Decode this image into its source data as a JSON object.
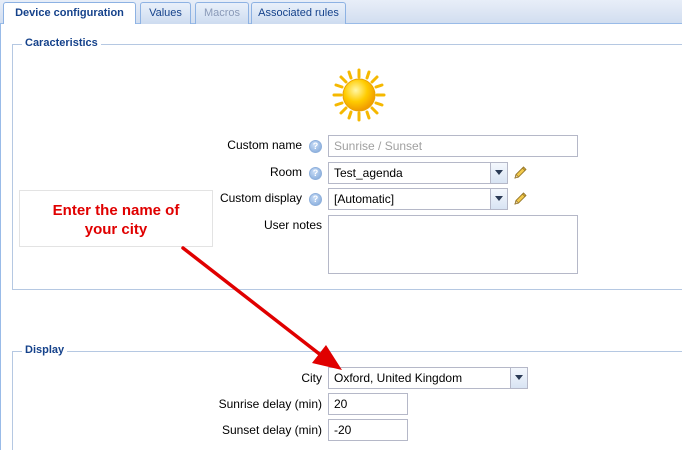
{
  "tabs": [
    {
      "label": "Device configuration",
      "active": true
    },
    {
      "label": "Values",
      "active": false
    },
    {
      "label": "Macros",
      "active": false,
      "disabled": true
    },
    {
      "label": "Associated rules",
      "active": false
    }
  ],
  "characteristics": {
    "legend": "Caracteristics",
    "device_icon": "sun-icon",
    "custom_name": {
      "label": "Custom name",
      "value": "",
      "placeholder": "Sunrise / Sunset"
    },
    "room": {
      "label": "Room",
      "value": "Test_agenda"
    },
    "custom_display": {
      "label": "Custom display",
      "value": "[Automatic]"
    },
    "user_notes": {
      "label": "User notes",
      "value": ""
    }
  },
  "display": {
    "legend": "Display",
    "city": {
      "label": "City",
      "value": "Oxford, United Kingdom"
    },
    "sunrise_delay": {
      "label": "Sunrise delay (min)",
      "value": "20"
    },
    "sunset_delay": {
      "label": "Sunset delay (min)",
      "value": "-20"
    }
  },
  "annotation": {
    "line1": "Enter the name of",
    "line2": "your city",
    "color": "#e00000"
  },
  "colors": {
    "accent": "#15428b",
    "tab_border": "#8db2e3",
    "background": "#dfe8f6"
  }
}
